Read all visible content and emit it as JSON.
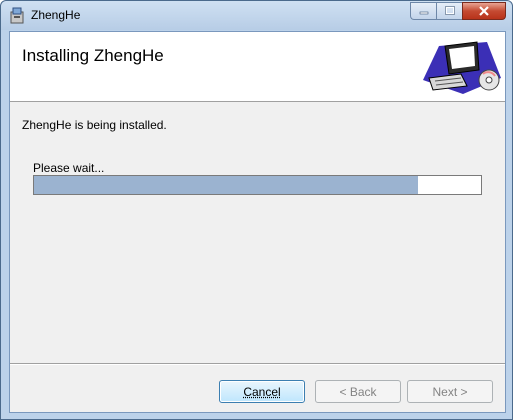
{
  "window": {
    "title": "ZhengHe"
  },
  "header": {
    "title": "Installing ZhengHe"
  },
  "body": {
    "status": "ZhengHe is being installed.",
    "wait_label": "Please wait...",
    "progress_percent": 86
  },
  "buttons": {
    "cancel": "Cancel",
    "back": "< Back",
    "next": "Next >"
  },
  "icons": {
    "app": "installer-package-icon",
    "header_art": "computer-setup-illustration"
  },
  "colors": {
    "progress_fill": "#9bb3d0",
    "close_button": "#c54a32"
  }
}
